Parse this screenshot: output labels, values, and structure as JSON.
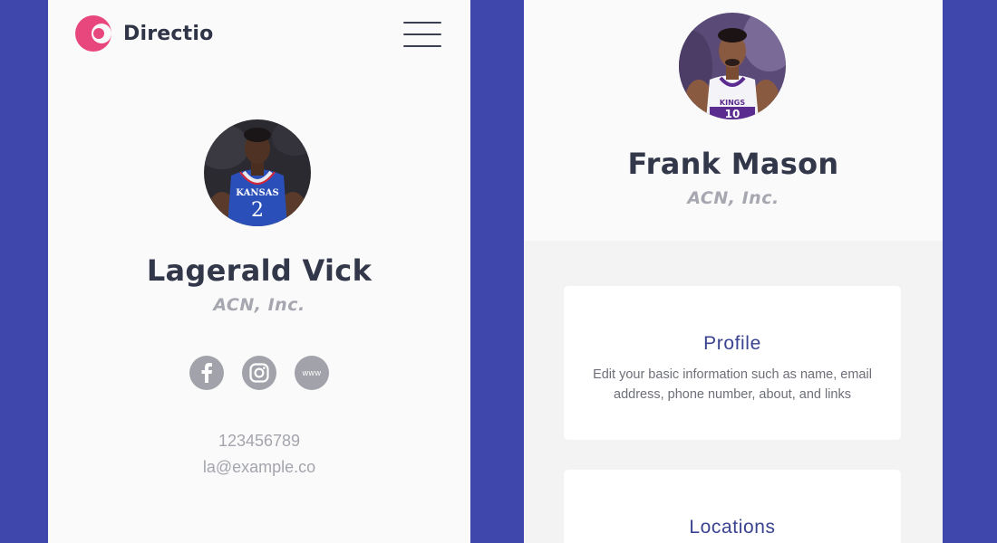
{
  "brand": {
    "name": "Directio",
    "logo_icon": "crescent-logo-icon",
    "logo_color": "#e8477e"
  },
  "menu": {
    "icon": "hamburger-menu-icon"
  },
  "left_profile": {
    "name": "Lagerald Vick",
    "company": "ACN, Inc.",
    "avatar": {
      "jersey_text": "KANSAS",
      "jersey_number": "2"
    },
    "socials": [
      {
        "icon": "facebook-icon"
      },
      {
        "icon": "instagram-icon"
      },
      {
        "icon": "www-icon",
        "label": "www"
      }
    ],
    "phone": "123456789",
    "email": "la@example.co"
  },
  "right_profile": {
    "name": "Frank Mason",
    "company": "ACN, Inc.",
    "avatar": {
      "jersey_text": "KINGS",
      "jersey_number": "10"
    },
    "cards": [
      {
        "title": "Profile",
        "description": "Edit your basic information such as name, email address, phone number, about, and links"
      },
      {
        "title": "Locations"
      }
    ]
  },
  "colors": {
    "background": "#3f47ad",
    "panel": "#fafafa",
    "text_dark": "#33374a",
    "text_muted": "#a6a7b0",
    "card_title": "#3a4390"
  }
}
